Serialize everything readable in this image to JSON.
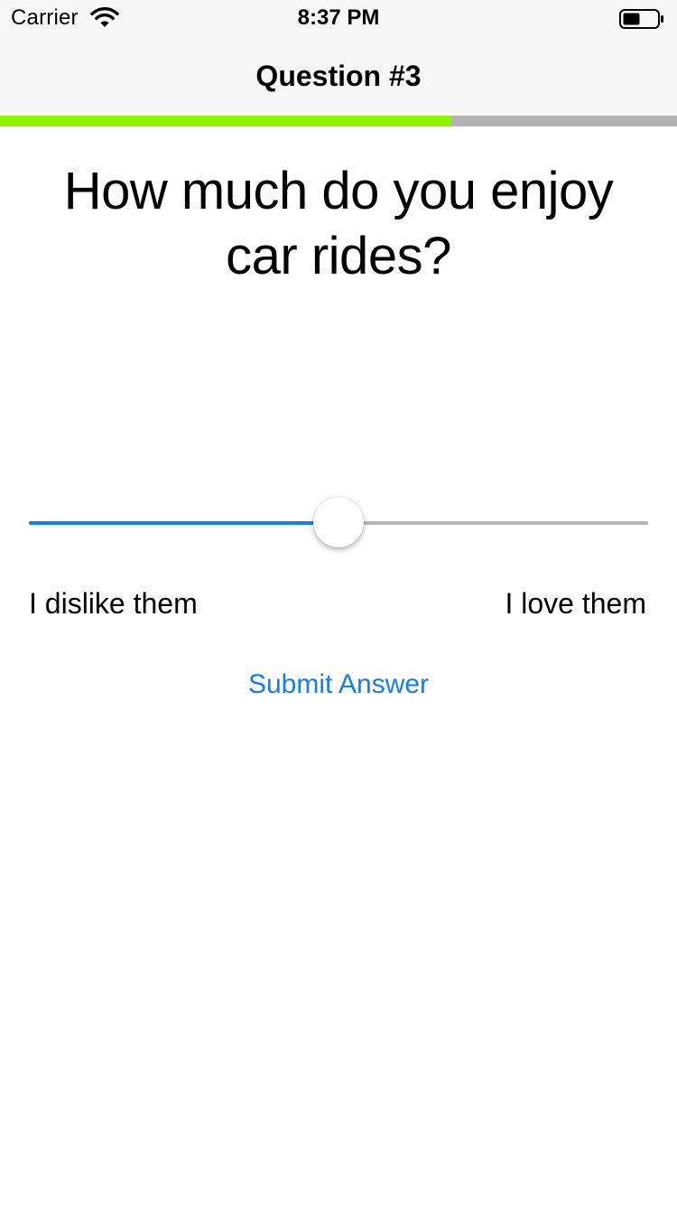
{
  "status_bar": {
    "carrier": "Carrier",
    "time": "8:37 PM",
    "battery_level": 0.5
  },
  "nav": {
    "title": "Question #3"
  },
  "progress": {
    "fraction": 0.667,
    "fill_color": "#8cf500",
    "track_color": "#b3b3b3"
  },
  "question": {
    "text": "How much do you enjoy car rides?"
  },
  "slider": {
    "value": 0.5,
    "min_label": "I dislike them",
    "max_label": "I love them",
    "accent_color": "#137df4"
  },
  "submit": {
    "label": "Submit Answer"
  }
}
